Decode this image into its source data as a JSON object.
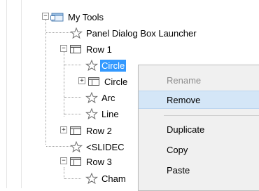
{
  "tree": {
    "root_label": "My Tools",
    "items": [
      {
        "label": "Panel Dialog Box Launcher",
        "icon": "star-icon"
      },
      {
        "label": "Row 1",
        "icon": "panel-row-icon",
        "expanded": true
      },
      {
        "label": "Circle",
        "icon": "star-icon",
        "selected": true
      },
      {
        "label": "Circle",
        "icon": "panel-row-icon",
        "expanded": false
      },
      {
        "label": "Arc",
        "icon": "star-icon"
      },
      {
        "label": "Line",
        "icon": "star-icon"
      },
      {
        "label": "Row 2",
        "icon": "panel-row-icon",
        "expanded": false
      },
      {
        "label": "<SLIDEC",
        "icon": "star-icon"
      },
      {
        "label": "Row 3",
        "icon": "panel-row-icon",
        "expanded": true
      },
      {
        "label": "Cham",
        "icon": "star-icon"
      }
    ],
    "toggle_expanded": "−",
    "toggle_collapsed": "+"
  },
  "context_menu": {
    "items": [
      {
        "label": "Rename",
        "state": "disabled"
      },
      {
        "label": "Remove",
        "state": "highlighted"
      },
      {
        "label": "Duplicate",
        "state": "normal"
      },
      {
        "label": "Copy",
        "state": "normal"
      },
      {
        "label": "Paste",
        "state": "normal"
      }
    ]
  },
  "colors": {
    "selection": "#3399ff",
    "menu_background": "#f0f0f0",
    "menu_highlight": "#d4e6f7",
    "disabled_text": "#8d8d8d"
  }
}
